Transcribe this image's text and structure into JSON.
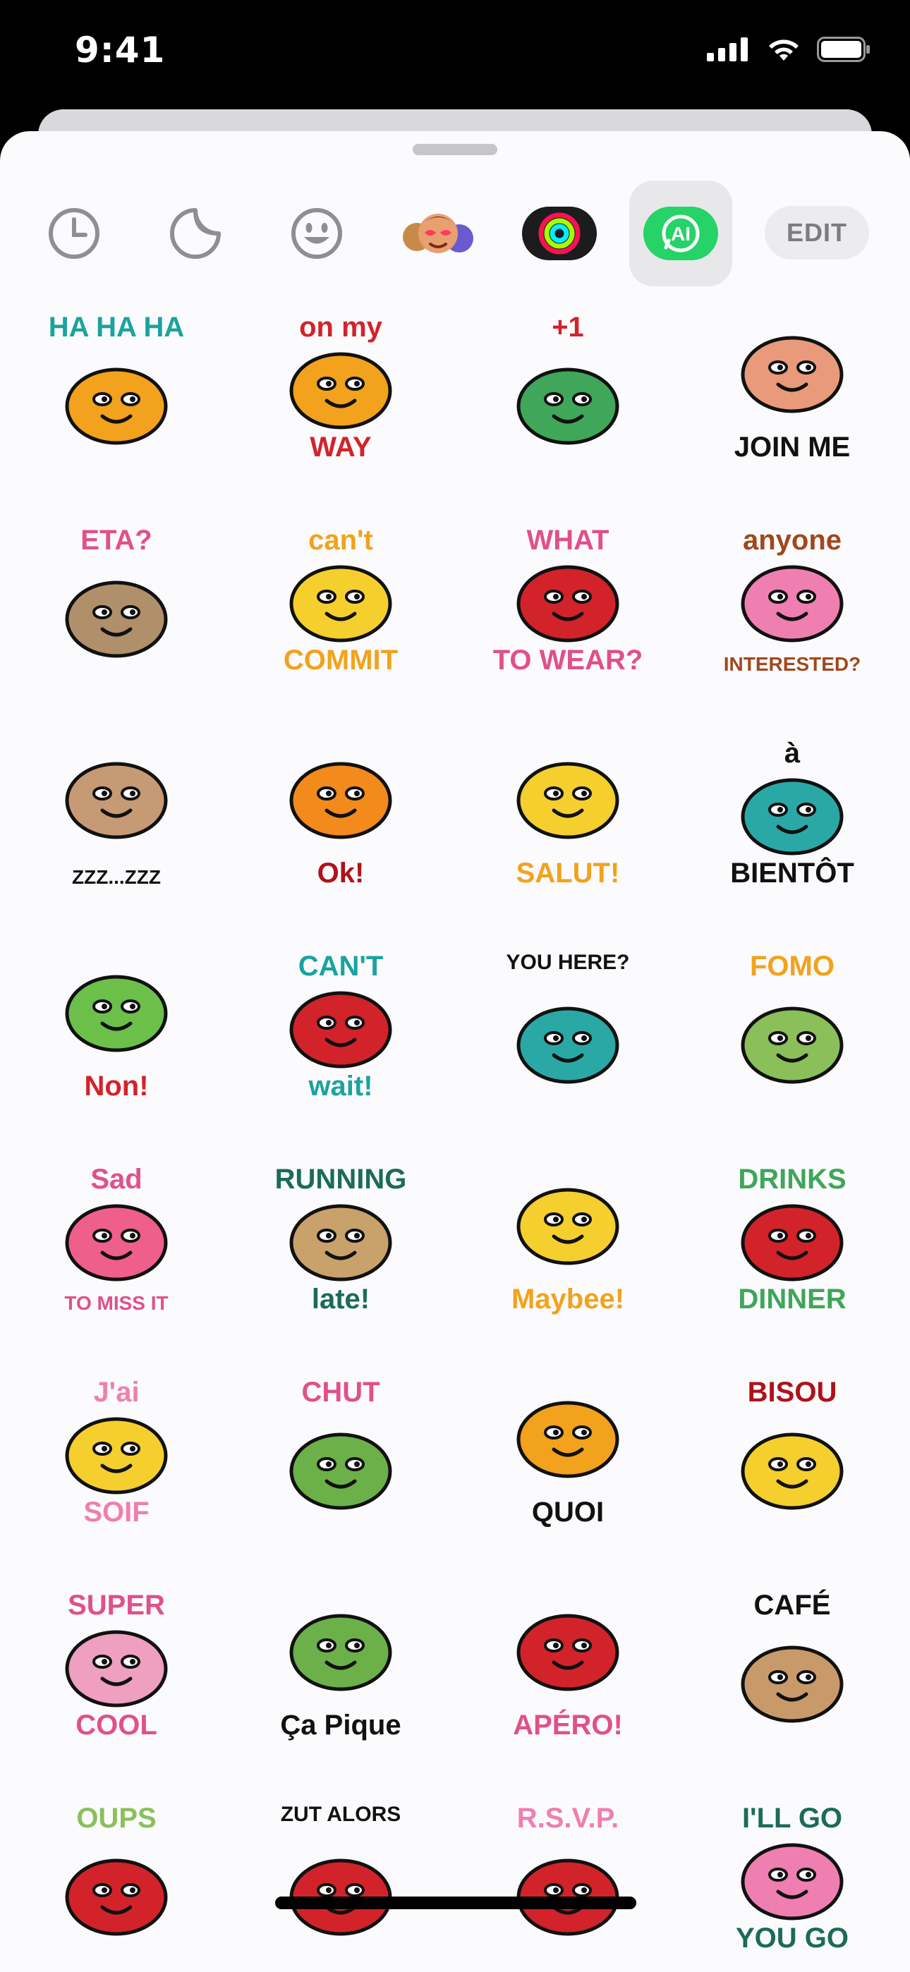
{
  "status_bar": {
    "time": "9:41"
  },
  "toolbar": {
    "tabs": [
      {
        "icon": "recents-clock-icon",
        "selected": false
      },
      {
        "icon": "sticker-peel-icon",
        "selected": false
      },
      {
        "icon": "smiley-emoji-icon",
        "selected": false
      },
      {
        "icon": "memoji-icon",
        "selected": false
      },
      {
        "icon": "activity-rings-icon",
        "selected": false
      },
      {
        "icon": "whatsapp-ai-icon",
        "selected": true
      }
    ],
    "edit_label": "EDIT"
  },
  "colors": {
    "whatsapp_green": "#25D366",
    "activity_red": "#FA114F",
    "activity_green": "#A6FF00",
    "activity_blue": "#00F0FF"
  },
  "stickers": [
    {
      "t1": "HA HA HA",
      "t2": "",
      "c1": "#1aa3a0",
      "body": "#f2a21c",
      "icon": "dog-laughing"
    },
    {
      "t1": "on my",
      "t2": "WAY",
      "c1": "#d2232a",
      "body": "#f2a21c",
      "icon": "dog-swinging"
    },
    {
      "t1": "+1",
      "t2": "",
      "c1": "#d2232a",
      "body": "#3fa65a",
      "icon": "cats-duo"
    },
    {
      "t1": "",
      "t2": "JOIN ME",
      "c1": "#111111",
      "body": "#e89a7a",
      "icon": "monkey-branch"
    },
    {
      "t1": "ETA?",
      "t2": "",
      "c1": "#e0508b",
      "body": "#b0906a",
      "icon": "elephant"
    },
    {
      "t1": "can't",
      "t2": "COMMIT",
      "c1": "#f2a21c",
      "body": "#f5cf2e",
      "icon": "dog-sleeping"
    },
    {
      "t1": "WHAT",
      "t2": "TO WEAR?",
      "c1": "#e0508b",
      "body": "#d2232a",
      "icon": "bird-dancing"
    },
    {
      "t1": "anyone",
      "t2": "INTERESTED?",
      "c1": "#a0481c",
      "body": "#ef7fb0",
      "icon": "cat-telescope"
    },
    {
      "t1": "",
      "t2": "ZZZ...ZZZ",
      "c1": "#111111",
      "body": "#c79a76",
      "icon": "bear-sleeping"
    },
    {
      "t1": "",
      "t2": "Ok!",
      "c1": "#b0121a",
      "body": "#f28a1c",
      "icon": "cat-ok"
    },
    {
      "t1": "",
      "t2": "SALUT!",
      "c1": "#f2a21c",
      "body": "#f5cf2e",
      "icon": "sun"
    },
    {
      "t1": "à",
      "t2": "BIENTÔT",
      "c1": "#111111",
      "body": "#2aa8a6",
      "icon": "plane"
    },
    {
      "t1": "",
      "t2": "Non!",
      "c1": "#d2232a",
      "body": "#6cc04a",
      "icon": "star"
    },
    {
      "t1": "CAN'T",
      "t2": "wait!",
      "c1": "#1aa3a0",
      "body": "#d2232a",
      "icon": "lips"
    },
    {
      "t1": "YOU HERE?",
      "t2": "",
      "c1": "#111111",
      "body": "#2aa8a6",
      "icon": "bubble"
    },
    {
      "t1": "FOMO",
      "t2": "",
      "c1": "#f2a21c",
      "body": "#8bbf5a",
      "icon": "ostrich"
    },
    {
      "t1": "Sad",
      "t2": "TO MISS IT",
      "c1": "#e0508b",
      "body": "#ef5f8c",
      "icon": "bunny-knot"
    },
    {
      "t1": "RUNNING",
      "t2": "late!",
      "c1": "#1b6b5a",
      "body": "#c8a26a",
      "icon": "snail"
    },
    {
      "t1": "",
      "t2": "Maybee!",
      "c1": "#f2a21c",
      "body": "#f5cf2e",
      "icon": "bee"
    },
    {
      "t1": "DRINKS",
      "t2": "DINNER",
      "c1": "#3fa65a",
      "body": "#d2232a",
      "icon": "glass-noodles"
    },
    {
      "t1": "J'ai",
      "t2": "SOIF",
      "c1": "#ef7fb0",
      "body": "#f5cf2e",
      "icon": "watering-can"
    },
    {
      "t1": "CHUT",
      "t2": "",
      "c1": "#e0508b",
      "body": "#6cb04a",
      "icon": "parrot"
    },
    {
      "t1": "",
      "t2": "QUOI",
      "c1": "#111111",
      "body": "#f2a21c",
      "icon": "question"
    },
    {
      "t1": "BISOU",
      "t2": "",
      "c1": "#b0121a",
      "body": "#f5cf2e",
      "icon": "cheese"
    },
    {
      "t1": "SUPER",
      "t2": "COOL",
      "c1": "#e0508b",
      "body": "#ef9fc0",
      "icon": "peace-hand"
    },
    {
      "t1": "",
      "t2": "Ça Pique",
      "c1": "#111111",
      "body": "#6cb04a",
      "icon": "cactus"
    },
    {
      "t1": "",
      "t2": "APÉRO!",
      "c1": "#e0508b",
      "body": "#d2232a",
      "icon": "wine-glass"
    },
    {
      "t1": "CAFÉ",
      "t2": "",
      "c1": "#111111",
      "body": "#c89a6a",
      "icon": "coffee-cup"
    },
    {
      "t1": "OUPS",
      "t2": "",
      "c1": "#8bbf5a",
      "body": "#d2232a",
      "icon": "apple-arrow"
    },
    {
      "t1": "ZUT ALORS",
      "t2": "",
      "c1": "#111111",
      "body": "#d2232a",
      "icon": "cherries"
    },
    {
      "t1": "R.S.V.P.",
      "t2": "",
      "c1": "#ef7fb0",
      "body": "#d2232a",
      "icon": "rose"
    },
    {
      "t1": "I'LL GO",
      "t2": "YOU GO",
      "c1": "#1b6b5a",
      "body": "#ef7fb0",
      "icon": "flowers"
    }
  ]
}
